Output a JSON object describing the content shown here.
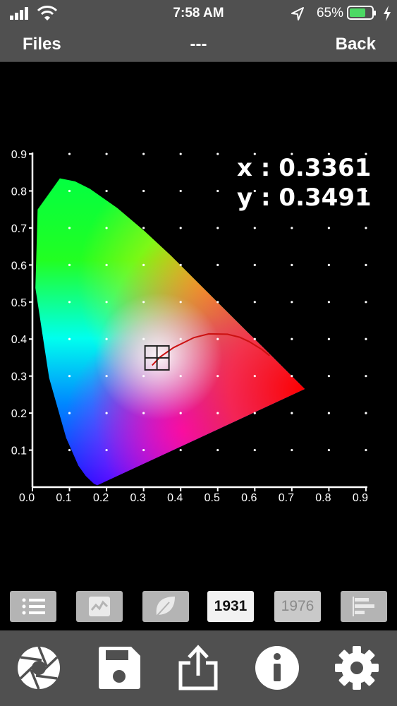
{
  "status_bar": {
    "time": "7:58 AM",
    "battery_percent": "65%",
    "icons": [
      "signal-bars-icon",
      "wifi-icon",
      "location-arrow-icon",
      "battery-icon",
      "charging-bolt-icon"
    ]
  },
  "nav": {
    "left_label": "Files",
    "title": "---",
    "right_label": "Back"
  },
  "readout": {
    "x_text": "x : 0.3361",
    "y_text": "y : 0.3491"
  },
  "chart_data": {
    "type": "scatter",
    "title": "",
    "xlabel": "",
    "ylabel": "",
    "xlim": [
      0,
      0.9
    ],
    "ylim": [
      0,
      0.9
    ],
    "x_ticks": [
      "0.0",
      "0.1",
      "0.2",
      "0.3",
      "0.4",
      "0.5",
      "0.6",
      "0.7",
      "0.8",
      "0.9"
    ],
    "y_ticks": [
      "0.1",
      "0.2",
      "0.3",
      "0.4",
      "0.5",
      "0.6",
      "0.7",
      "0.8",
      "0.9"
    ],
    "grid": "dots",
    "gamut_locus": [
      [
        0.175,
        0.005
      ],
      [
        0.166,
        0.009
      ],
      [
        0.144,
        0.03
      ],
      [
        0.124,
        0.058
      ],
      [
        0.091,
        0.133
      ],
      [
        0.045,
        0.295
      ],
      [
        0.008,
        0.538
      ],
      [
        0.014,
        0.75
      ],
      [
        0.074,
        0.834
      ],
      [
        0.115,
        0.826
      ],
      [
        0.155,
        0.806
      ],
      [
        0.229,
        0.754
      ],
      [
        0.302,
        0.692
      ],
      [
        0.374,
        0.625
      ],
      [
        0.444,
        0.555
      ],
      [
        0.512,
        0.487
      ],
      [
        0.575,
        0.424
      ],
      [
        0.627,
        0.373
      ],
      [
        0.666,
        0.334
      ],
      [
        0.692,
        0.308
      ],
      [
        0.735,
        0.265
      ]
    ],
    "planckian_locus": [
      [
        0.323,
        0.329
      ],
      [
        0.345,
        0.352
      ],
      [
        0.381,
        0.377
      ],
      [
        0.436,
        0.404
      ],
      [
        0.476,
        0.414
      ],
      [
        0.526,
        0.413
      ],
      [
        0.559,
        0.405
      ],
      [
        0.585,
        0.393
      ],
      [
        0.619,
        0.372
      ],
      [
        0.64,
        0.355
      ]
    ],
    "point": {
      "x": 0.3361,
      "y": 0.3491
    },
    "colors": {
      "locus": "#cc1111",
      "marker": "#222222",
      "axis": "#ffffff",
      "grid_dot": "#ffffff"
    }
  },
  "mode_buttons": [
    {
      "name": "list-view-button",
      "icon": "list-icon",
      "label": "",
      "state": "normal"
    },
    {
      "name": "spectrum-view-button",
      "icon": "spectrum-graph-icon",
      "label": "",
      "state": "normal"
    },
    {
      "name": "cri-view-button",
      "icon": "leaf-icon",
      "label": "",
      "state": "normal"
    },
    {
      "name": "cie1931-button",
      "icon": "",
      "label": "1931",
      "state": "active"
    },
    {
      "name": "cie1976-button",
      "icon": "",
      "label": "1976",
      "state": "dim"
    },
    {
      "name": "bar-view-button",
      "icon": "bar-chart-icon",
      "label": "",
      "state": "normal"
    }
  ],
  "toolbar": [
    {
      "name": "capture-button",
      "icon": "aperture-icon"
    },
    {
      "name": "save-button",
      "icon": "floppy-disk-icon"
    },
    {
      "name": "share-button",
      "icon": "share-icon"
    },
    {
      "name": "info-button",
      "icon": "info-icon"
    },
    {
      "name": "settings-button",
      "icon": "gear-icon"
    }
  ]
}
